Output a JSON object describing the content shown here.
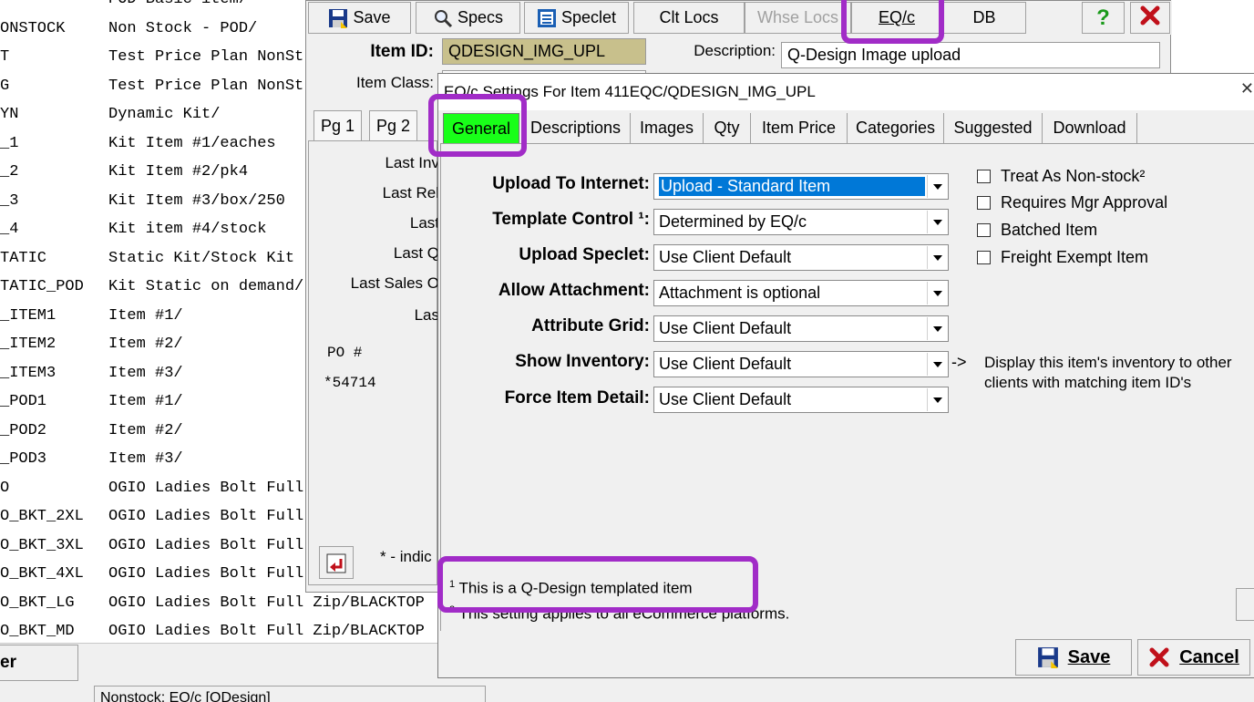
{
  "background_list": {
    "rows": [
      {
        "code": "",
        "desc": "POD Basic item/"
      },
      {
        "code": "ONSTOCK",
        "desc": "Non Stock - POD/"
      },
      {
        "code": "T",
        "desc": "Test Price Plan NonSt"
      },
      {
        "code": "G",
        "desc": "Test Price Plan NonSt"
      },
      {
        "code": "YN",
        "desc": "Dynamic Kit/"
      },
      {
        "code": "_1",
        "desc": "Kit Item #1/eaches"
      },
      {
        "code": "_2",
        "desc": "Kit Item #2/pk4"
      },
      {
        "code": "_3",
        "desc": "Kit Item #3/box/250"
      },
      {
        "code": "_4",
        "desc": "Kit item #4/stock"
      },
      {
        "code": "TATIC",
        "desc": "Static Kit/Stock Kit"
      },
      {
        "code": "TATIC_POD",
        "desc": "Kit Static on demand/"
      },
      {
        "code": "_ITEM1",
        "desc": "Item #1/"
      },
      {
        "code": "_ITEM2",
        "desc": "Item #2/"
      },
      {
        "code": "_ITEM3",
        "desc": "Item #3/"
      },
      {
        "code": "_POD1",
        "desc": "Item #1/"
      },
      {
        "code": "_POD2",
        "desc": "Item #2/"
      },
      {
        "code": "_POD3",
        "desc": "Item #3/"
      },
      {
        "code": "O",
        "desc": "OGIO Ladies Bolt Full"
      },
      {
        "code": "O_BKT_2XL",
        "desc": "OGIO Ladies Bolt Full"
      },
      {
        "code": "O_BKT_3XL",
        "desc": "OGIO Ladies Bolt Full"
      },
      {
        "code": "O_BKT_4XL",
        "desc": "OGIO Ladies Bolt Full"
      },
      {
        "code": "O_BKT_LG",
        "desc": "OGIO Ladies Bolt Full Zip/BLACKTOP"
      },
      {
        "code": "O_BKT_MD",
        "desc": "OGIO Ladies Bolt Full Zip/BLACKTOP"
      }
    ],
    "bottom_button": "er",
    "status_text": "Nonstock: EQ/c [QDesign]"
  },
  "item_window": {
    "toolbar": {
      "save": "Save",
      "specs": "Specs",
      "speclet": "Speclet",
      "clt_locs": "Clt Locs",
      "whse_locs": "Whse Locs",
      "eqc": "EQ/c",
      "db": "DB",
      "help": "?"
    },
    "item_id_label": "Item ID:",
    "item_id_value": "QDESIGN_IMG_UPL",
    "description_label": "Description:",
    "description_value": "Q-Design Image upload",
    "item_class_label": "Item Class:",
    "page_tabs": [
      "Pg 1",
      "Pg 2"
    ],
    "left_labels": [
      "Last Inv",
      "Last Rel",
      "Last",
      "Last Q",
      "Last Sales O",
      "Las"
    ],
    "po_label": "PO #",
    "po_value": "*54714",
    "indicator_note": "* - indic"
  },
  "dialog": {
    "title": "EQ/c Settings For Item 411EQC/QDESIGN_IMG_UPL",
    "tabs": [
      "General",
      "Descriptions",
      "Images",
      "Qty",
      "Item Price",
      "Categories",
      "Suggested",
      "Download"
    ],
    "active_tab": "General",
    "fields": [
      {
        "label": "Upload To Internet:",
        "value": "Upload - Standard Item"
      },
      {
        "label": "Template Control ¹:",
        "value": "Determined by EQ/c"
      },
      {
        "label": "Upload Speclet:",
        "value": "Use Client Default"
      },
      {
        "label": "Allow Attachment:",
        "value": "Attachment is optional"
      },
      {
        "label": "Attribute Grid:",
        "value": "Use Client Default"
      },
      {
        "label": "Show Inventory:",
        "value": "Use Client Default"
      },
      {
        "label": "Force Item Detail:",
        "value": "Use Client Default"
      }
    ],
    "checkboxes": [
      {
        "label": "Treat As Non-stock²",
        "checked": false
      },
      {
        "label": "Requires Mgr Approval",
        "checked": false
      },
      {
        "label": "Batched Item",
        "checked": false
      },
      {
        "label": "Freight Exempt Item",
        "checked": false
      }
    ],
    "inventory_arrow": "->",
    "inventory_note": "Display this item's inventory to other clients with matching item ID's",
    "footnote1_mark": "1",
    "footnote1": "This is a Q-Design templated item",
    "footnote2_mark": "2",
    "footnote2": "This setting applies to all eCommerce platforms.",
    "save_button": "Save",
    "cancel_button": "Cancel"
  },
  "colors": {
    "highlight": "#a12cc7",
    "active_tab": "#19ff19",
    "item_id_bg": "#c8c08c",
    "selection": "#0078d7"
  }
}
